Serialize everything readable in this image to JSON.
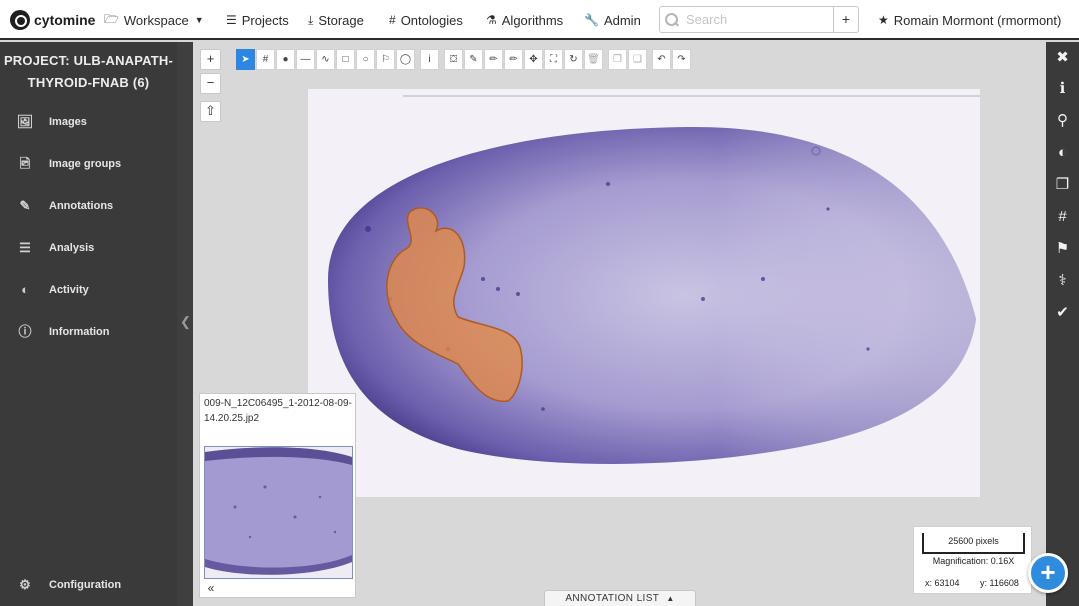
{
  "brand": {
    "name": "cytomine",
    "icon": "cytomine-logo-icon"
  },
  "nav": {
    "workspace": "Workspace",
    "projects": "Projects",
    "storage": "Storage",
    "ontologies": "Ontologies",
    "algorithms": "Algorithms",
    "admin": "Admin",
    "search_placeholder": "Search",
    "add_label": "+",
    "user": "Romain Mormont (rmormont)"
  },
  "sidebar": {
    "project_title": "PROJECT: ULB-ANAPATH-THYROID-FNAB (6)",
    "items": [
      {
        "label": "Images",
        "icon": "image-icon"
      },
      {
        "label": "Image groups",
        "icon": "images-icon"
      },
      {
        "label": "Annotations",
        "icon": "edit-icon"
      },
      {
        "label": "Analysis",
        "icon": "tasks-icon"
      },
      {
        "label": "Activity",
        "icon": "gauge-icon"
      },
      {
        "label": "Information",
        "icon": "info-icon"
      }
    ],
    "configuration": "Configuration"
  },
  "viewer": {
    "zoom_in": "+",
    "zoom_out": "−",
    "overview_name": "009-N_12C06495_1-2012-08-09-14.20.25.jp2",
    "scale_label": "25600 pixels",
    "magnification": "Magnification: 0.16X",
    "coord_x": "x: 63104",
    "coord_y": "y: 116608",
    "annotation_list": "ANNOTATION LIST"
  },
  "colors": {
    "accent": "#2d86e0",
    "sidebar_bg": "#3a3a3a",
    "stain": "#5a4aa0",
    "annotation_fill": "#e08a4a"
  }
}
